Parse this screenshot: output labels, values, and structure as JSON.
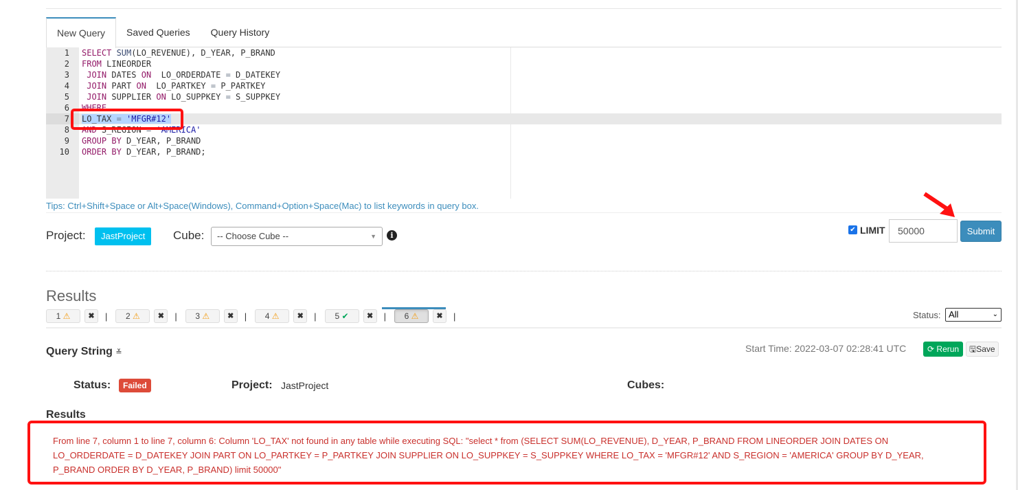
{
  "tabs": [
    {
      "label": "New Query",
      "active": true
    },
    {
      "label": "Saved Queries"
    },
    {
      "label": "Query History"
    }
  ],
  "editor": {
    "current_line": 7,
    "lines": [
      [
        [
          "kw",
          "SELECT "
        ],
        [
          "fn",
          "SUM"
        ],
        [
          "t",
          "(LO_REVENUE), D_YEAR, P_BRAND"
        ]
      ],
      [
        [
          "kw",
          "FROM "
        ],
        [
          "t",
          "LINEORDER"
        ]
      ],
      [
        [
          "t",
          " "
        ],
        [
          "kw",
          "JOIN "
        ],
        [
          "t",
          "DATES "
        ],
        [
          "kw",
          "ON "
        ],
        [
          "t",
          " LO_ORDERDATE "
        ],
        [
          "op",
          "="
        ],
        [
          "t",
          " D_DATEKEY"
        ]
      ],
      [
        [
          "t",
          " "
        ],
        [
          "kw",
          "JOIN "
        ],
        [
          "t",
          "PART "
        ],
        [
          "kw",
          "ON "
        ],
        [
          "t",
          " LO_PARTKEY "
        ],
        [
          "op",
          "="
        ],
        [
          "t",
          " P_PARTKEY"
        ]
      ],
      [
        [
          "t",
          " "
        ],
        [
          "kw",
          "JOIN "
        ],
        [
          "t",
          "SUPPLIER "
        ],
        [
          "kw",
          "ON "
        ],
        [
          "t",
          "LO_SUPPKEY "
        ],
        [
          "op",
          "="
        ],
        [
          "t",
          " S_SUPPKEY"
        ]
      ],
      [
        [
          "kw",
          "WHERE"
        ]
      ],
      [
        [
          "sel",
          "LO_TAX "
        ],
        [
          "selop",
          "="
        ],
        [
          "sel",
          " "
        ],
        [
          "selstr",
          "'MFGR#12'"
        ]
      ],
      [
        [
          "kw",
          "AND "
        ],
        [
          "t",
          "S_REGION "
        ],
        [
          "op",
          "="
        ],
        [
          "t",
          " "
        ],
        [
          "str",
          "'AMERICA'"
        ]
      ],
      [
        [
          "kw",
          "GROUP BY "
        ],
        [
          "t",
          "D_YEAR, P_BRAND"
        ]
      ],
      [
        [
          "kw",
          "ORDER BY "
        ],
        [
          "t",
          "D_YEAR, P_BRAND;"
        ]
      ]
    ]
  },
  "tips": "Tips: Ctrl+Shift+Space or Alt+Space(Windows), Command+Option+Space(Mac) to list keywords in query box.",
  "project": {
    "label": "Project:",
    "value": "JastProject"
  },
  "cube": {
    "label": "Cube:",
    "placeholder": "-- Choose Cube --",
    "info_icon": "info-circle-icon"
  },
  "limit": {
    "checked": true,
    "label": "LIMIT",
    "value": "50000"
  },
  "submit_label": "Submit",
  "results_heading": "Results",
  "query_tabs": [
    {
      "label": "1",
      "status": "warning"
    },
    {
      "label": "2",
      "status": "warning"
    },
    {
      "label": "3",
      "status": "warning"
    },
    {
      "label": "4",
      "status": "warning"
    },
    {
      "label": "5",
      "status": "success"
    },
    {
      "label": "6",
      "status": "warning",
      "active": true
    }
  ],
  "status_filter": {
    "label": "Status:",
    "value": "All"
  },
  "detail": {
    "query_string_label": "Query String",
    "start_time": "Start Time: 2022-03-07 02:28:41 UTC",
    "rerun_label": "Rerun",
    "save_label": "Save",
    "status_label": "Status:",
    "status_value": "Failed",
    "project_label": "Project:",
    "project_value": "JastProject",
    "cubes_label": "Cubes:",
    "results_label": "Results",
    "error": "From line 7, column 1 to line 7, column 6: Column 'LO_TAX' not found in any table while executing SQL: \"select * from (SELECT SUM(LO_REVENUE), D_YEAR, P_BRAND FROM LINEORDER JOIN DATES ON LO_ORDERDATE = D_DATEKEY JOIN PART ON LO_PARTKEY = P_PARTKEY JOIN SUPPLIER ON LO_SUPPKEY = S_SUPPKEY WHERE LO_TAX = 'MFGR#12' AND S_REGION = 'AMERICA' GROUP BY D_YEAR, P_BRAND ORDER BY D_YEAR, P_BRAND) limit 50000\""
  },
  "colors": {
    "accent": "#3c8dbc",
    "failed": "#dd4b39",
    "success": "#00a65a",
    "warning": "#f39c12",
    "annotation": "#ff1111"
  }
}
